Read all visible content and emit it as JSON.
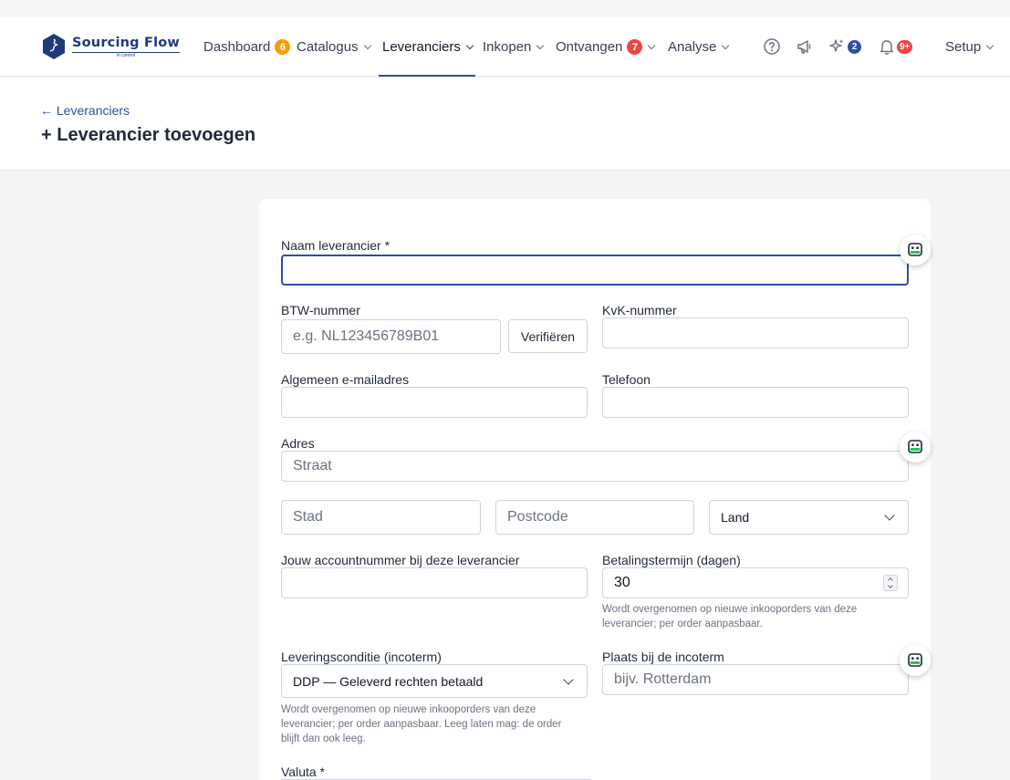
{
  "app": {
    "logo_name": "Sourcing Flow",
    "logo_tagline": "in control",
    "brand_color": "#1e3a7b",
    "accent_color": "#2b4fa8"
  },
  "nav": {
    "dashboard": {
      "label": "Dashboard",
      "badge": "6"
    },
    "catalogus": {
      "label": "Catalogus"
    },
    "leveranciers": {
      "label": "Leveranciers"
    },
    "inkopen": {
      "label": "Inkopen"
    },
    "ontvangen": {
      "label": "Ontvangen",
      "badge": "7"
    },
    "analyse": {
      "label": "Analyse"
    },
    "ai_badge": "2",
    "notifications_badge": "9+",
    "setup": {
      "label": "Setup"
    }
  },
  "header": {
    "back_link": "← Leveranciers",
    "title": "+ Leverancier toevoegen"
  },
  "form": {
    "name": {
      "label": "Naam leverancier *",
      "value": ""
    },
    "vat": {
      "label": "BTW-nummer",
      "placeholder": "e.g. NL123456789B01",
      "verify_label": "Verifiëren"
    },
    "kvk": {
      "label": "KvK-nummer",
      "value": ""
    },
    "email": {
      "label": "Algemeen e-mailadres",
      "value": ""
    },
    "phone": {
      "label": "Telefoon",
      "value": ""
    },
    "address": {
      "label": "Adres",
      "street_placeholder": "Straat",
      "city_placeholder": "Stad",
      "postcode_placeholder": "Postcode",
      "country_value": "Land"
    },
    "account_number": {
      "label": "Jouw accountnummer bij deze leverancier",
      "value": ""
    },
    "payment_terms": {
      "label": "Betalingstermijn (dagen)",
      "value": "30",
      "hint": "Wordt overgenomen op nieuwe inkooporders van deze leverancier; per order aanpasbaar."
    },
    "incoterm": {
      "label": "Leveringsconditie (incoterm)",
      "value": "DDP — Geleverd rechten betaald",
      "hint": "Wordt overgenomen op nieuwe inkooporders van deze leverancier; per order aanpasbaar. Leeg laten mag: de order blijft dan ook leeg."
    },
    "incoterm_place": {
      "label": "Plaats bij de incoterm",
      "placeholder": "bijv. Rotterdam"
    },
    "currency": {
      "label": "Valuta *"
    }
  },
  "icons": {
    "help": "help-circle-icon",
    "announcements": "megaphone-icon",
    "ai": "sparkles-icon",
    "notifications": "bell-icon",
    "assistant": "robot-assistant-icon"
  }
}
